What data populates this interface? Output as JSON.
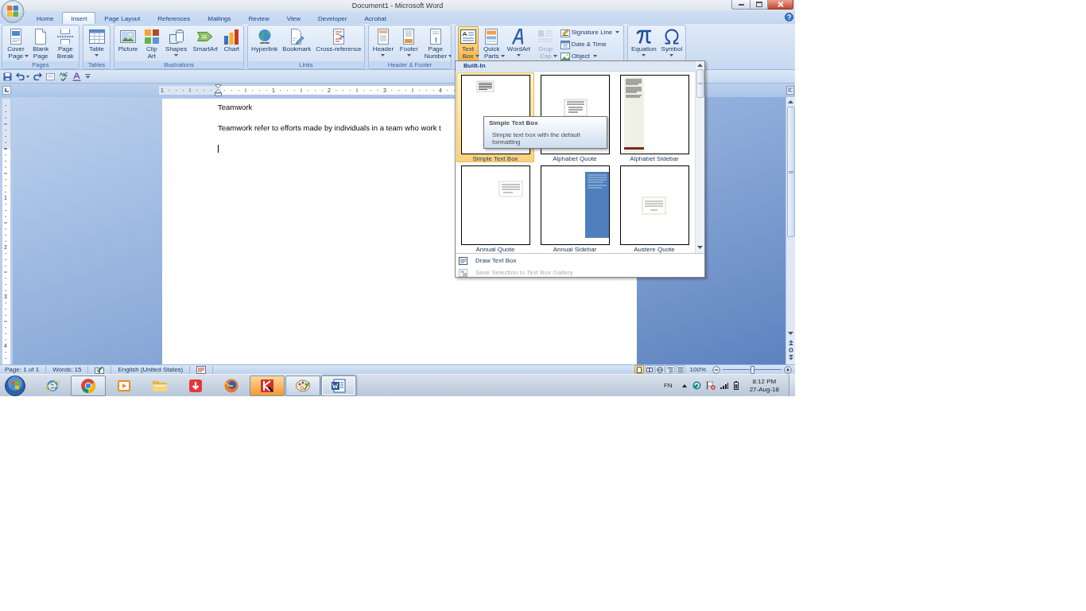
{
  "window": {
    "title": "Document1 - Microsoft Word"
  },
  "tabs": [
    {
      "label": "Home",
      "selected": false
    },
    {
      "label": "Insert",
      "selected": true
    },
    {
      "label": "Page Layout",
      "selected": false
    },
    {
      "label": "References",
      "selected": false
    },
    {
      "label": "Mailings",
      "selected": false
    },
    {
      "label": "Review",
      "selected": false
    },
    {
      "label": "View",
      "selected": false
    },
    {
      "label": "Developer",
      "selected": false
    },
    {
      "label": "Acrobat",
      "selected": false
    }
  ],
  "ribbon": {
    "groups": [
      {
        "label": "Pages",
        "buttons": [
          {
            "kind": "large",
            "label": "Cover Page",
            "dropdown": true,
            "pressed": false,
            "disabled": false
          },
          {
            "kind": "large",
            "label": "Blank Page",
            "dropdown": false,
            "pressed": false,
            "disabled": false
          },
          {
            "kind": "large",
            "label": "Page Break",
            "dropdown": false,
            "pressed": false,
            "disabled": false
          }
        ]
      },
      {
        "label": "Tables",
        "buttons": [
          {
            "kind": "large",
            "label": "Table",
            "dropdown": true,
            "pressed": false,
            "disabled": false
          }
        ]
      },
      {
        "label": "Illustrations",
        "buttons": [
          {
            "kind": "large",
            "label": "Picture",
            "dropdown": false,
            "pressed": false,
            "disabled": false
          },
          {
            "kind": "large",
            "label": "Clip Art",
            "dropdown": false,
            "pressed": false,
            "disabled": false
          },
          {
            "kind": "large",
            "label": "Shapes",
            "dropdown": true,
            "pressed": false,
            "disabled": false
          },
          {
            "kind": "large",
            "label": "SmartArt",
            "dropdown": false,
            "pressed": false,
            "disabled": false
          },
          {
            "kind": "large",
            "label": "Chart",
            "dropdown": false,
            "pressed": false,
            "disabled": false
          }
        ]
      },
      {
        "label": "Links",
        "buttons": [
          {
            "kind": "large",
            "label": "Hyperlink",
            "dropdown": false,
            "pressed": false,
            "disabled": false
          },
          {
            "kind": "large",
            "label": "Bookmark",
            "dropdown": false,
            "pressed": false,
            "disabled": false
          },
          {
            "kind": "large",
            "label": "Cross-reference",
            "dropdown": false,
            "pressed": false,
            "disabled": false
          }
        ]
      },
      {
        "label": "Header & Footer",
        "buttons": [
          {
            "kind": "large",
            "label": "Header",
            "dropdown": true,
            "pressed": false,
            "disabled": false
          },
          {
            "kind": "large",
            "label": "Footer",
            "dropdown": true,
            "pressed": false,
            "disabled": false
          },
          {
            "kind": "large",
            "label": "Page Number",
            "dropdown": true,
            "pressed": false,
            "disabled": false
          }
        ]
      },
      {
        "buttons": [
          {
            "kind": "large",
            "label": "Text Box",
            "dropdown": true,
            "pressed": true,
            "disabled": false
          },
          {
            "kind": "large",
            "label": "Quick Parts",
            "dropdown": true,
            "pressed": false,
            "disabled": false
          },
          {
            "kind": "large",
            "label": "WordArt",
            "dropdown": true,
            "pressed": false,
            "disabled": false
          },
          {
            "kind": "large",
            "label": "Drop Cap",
            "dropdown": true,
            "pressed": false,
            "disabled": true
          },
          {
            "kind": "small",
            "label": "Signature Line",
            "dropdown": true,
            "pressed": false,
            "disabled": false
          },
          {
            "kind": "small",
            "label": "Date & Time",
            "dropdown": false,
            "pressed": false,
            "disabled": false
          },
          {
            "kind": "small",
            "label": "Object",
            "dropdown": true,
            "pressed": false,
            "disabled": false
          }
        ]
      },
      {
        "buttons": [
          {
            "kind": "large",
            "label": "Equation",
            "dropdown": true,
            "pressed": false,
            "disabled": false
          },
          {
            "kind": "large",
            "label": "Symbol",
            "dropdown": true,
            "pressed": false,
            "disabled": false
          }
        ]
      }
    ]
  },
  "ruler": {
    "numbers": [
      "1",
      "1",
      "2",
      "3",
      "4"
    ]
  },
  "vertical_ruler": {
    "numbers": [
      "1",
      "2",
      "3",
      "4"
    ]
  },
  "document": {
    "paragraphs": [
      "Teamwork",
      "Teamwork refer to efforts made by individuals in a team who work t"
    ]
  },
  "gallery": {
    "header": "Built-In",
    "items": [
      {
        "label": "Simple Text Box",
        "selected": true
      },
      {
        "label": "Alphabet Quote",
        "selected": false
      },
      {
        "label": "Alphabet Sidebar",
        "selected": false
      },
      {
        "label": "Annual Quote",
        "selected": false
      },
      {
        "label": "Annual Sidebar",
        "selected": false
      },
      {
        "label": "Austere Quote",
        "selected": false
      }
    ],
    "tooltip": {
      "title": "Simple Text Box",
      "text": "Simple text box with the default formatting"
    },
    "menu": [
      {
        "label": "Draw Text Box",
        "disabled": false
      },
      {
        "label": "Save Selection to Text Box Gallery",
        "disabled": true
      }
    ]
  },
  "status_bar": {
    "page": "Page: 1 of 1",
    "words": "Words: 15",
    "language": "English (United States)",
    "views": [
      {
        "selected": true
      },
      {
        "selected": false
      },
      {
        "selected": false
      },
      {
        "selected": false
      },
      {
        "selected": false
      }
    ],
    "zoom": {
      "reading": "100%",
      "level": 0.5
    }
  },
  "taskbar": {
    "apps": [
      {
        "running": false,
        "flashing": false,
        "active": false
      },
      {
        "running": true,
        "flashing": false,
        "active": false
      },
      {
        "running": false,
        "flashing": false,
        "active": false
      },
      {
        "running": false,
        "flashing": false,
        "active": false
      },
      {
        "running": false,
        "flashing": false,
        "active": false
      },
      {
        "running": false,
        "flashing": false,
        "active": false
      },
      {
        "running": true,
        "flashing": true,
        "active": false
      },
      {
        "running": true,
        "flashing": false,
        "active": false
      },
      {
        "running": true,
        "flashing": false,
        "active": true
      }
    ],
    "input_language": "FN",
    "clock": {
      "time": "8:12 PM",
      "date": "27-Aug-18"
    }
  }
}
